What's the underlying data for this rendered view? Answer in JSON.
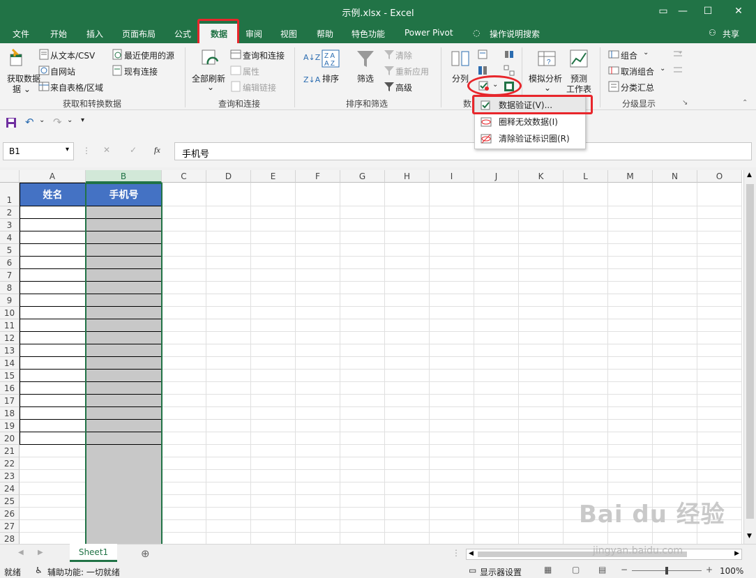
{
  "window": {
    "title": "示例.xlsx  -  Excel"
  },
  "tabs": [
    "文件",
    "开始",
    "插入",
    "页面布局",
    "公式",
    "数据",
    "审阅",
    "视图",
    "帮助",
    "特色功能",
    "Power Pivot",
    "操作说明搜索"
  ],
  "share_label": "共享",
  "ribbon": {
    "get_data": "获取数据",
    "from_text_csv": "从文本/CSV",
    "from_web": "自网站",
    "from_table": "来自表格/区域",
    "recent_sources": "最近使用的源",
    "existing_connections": "现有连接",
    "group_get_transform": "获取和转换数据",
    "refresh_all": "全部刷新",
    "queries_connections": "查询和连接",
    "properties": "属性",
    "edit_links": "编辑链接",
    "group_queries": "查询和连接",
    "sort": "排序",
    "filter": "筛选",
    "clear": "清除",
    "reapply": "重新应用",
    "advanced": "高级",
    "group_sort_filter": "排序和筛选",
    "text_to_columns": "分列",
    "group_data_tools": "数",
    "what_if": "模拟分析",
    "forecast_line1": "预测",
    "forecast_line2": "工作表",
    "group_forecast": "",
    "group": "组合",
    "ungroup": "取消组合",
    "subtotal": "分类汇总",
    "group_outline": "分级显示"
  },
  "dropdown": {
    "items": [
      "数据验证(V)...",
      "圈释无效数据(I)",
      "清除验证标识圈(R)"
    ]
  },
  "formula_bar": {
    "name_box": "B1",
    "fx": "fx",
    "value": "手机号"
  },
  "columns": [
    "A",
    "B",
    "C",
    "D",
    "E",
    "F",
    "G",
    "H",
    "I",
    "J",
    "K",
    "L",
    "M",
    "N",
    "O"
  ],
  "rows": [
    "1",
    "2",
    "3",
    "4",
    "5",
    "6",
    "7",
    "8",
    "9",
    "10",
    "11",
    "12",
    "13",
    "14",
    "15",
    "16",
    "17",
    "18",
    "19",
    "20",
    "21",
    "22",
    "23",
    "24",
    "25",
    "26",
    "27",
    "28"
  ],
  "cells": {
    "A1": "姓名",
    "B1": "手机号"
  },
  "sheet_tab": "Sheet1",
  "status": {
    "ready": "就绪",
    "accessibility": "辅助功能: 一切就绪",
    "display_settings": "显示器设置",
    "zoom": "100%"
  },
  "watermark": {
    "main": "Bai du 经验",
    "url": "jingyan.baidu.com"
  },
  "colors": {
    "excel_green": "#217346",
    "header_blue": "#4472c4",
    "gray_fill": "#c8c8c8",
    "highlight_red": "#e8262b"
  }
}
